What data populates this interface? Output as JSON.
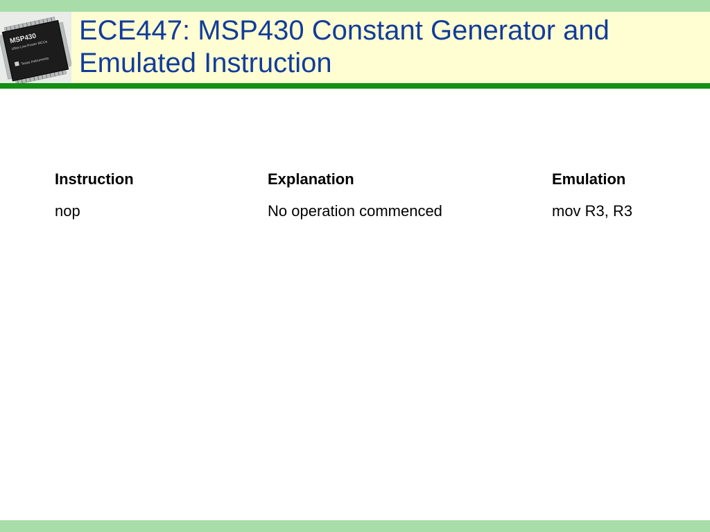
{
  "slide": {
    "title": "ECE447: MSP430 Constant Generator and Emulated Instruction",
    "logo": {
      "icon": "msp430-chip-icon",
      "chip_label": "MSP430",
      "chip_sublabel": "Ultra-Low-Power MCUs",
      "maker": "Texas Instruments"
    }
  },
  "table": {
    "headers": [
      "Instruction",
      "Explanation",
      "Emulation"
    ],
    "rows": [
      [
        "nop",
        "No operation commenced",
        "mov R3, R3"
      ]
    ]
  },
  "colors": {
    "title": "#123c9b",
    "band": "#a8dca8",
    "header_bg": "#fefed2",
    "rule": "#138f13"
  }
}
